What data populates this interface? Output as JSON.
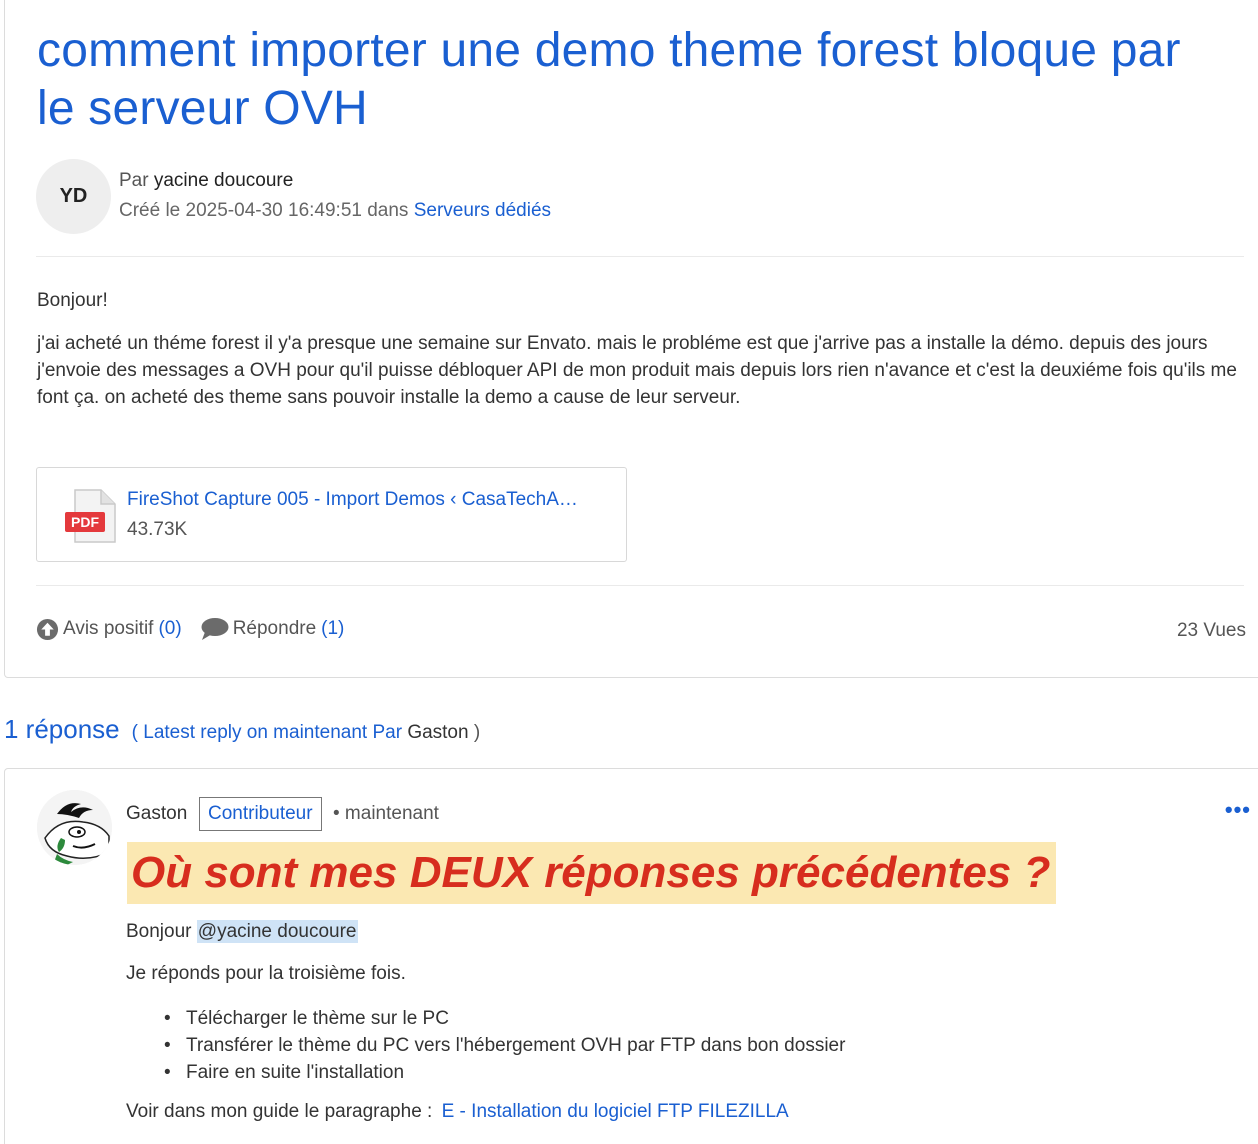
{
  "topic": {
    "title": "comment importer une demo theme forest bloque par le serveur OVH",
    "avatar_initials": "YD",
    "by_label": "Par",
    "author": "yacine doucoure",
    "created_label": "Créé le 2025-04-30 16:49:51 dans",
    "category": "Serveurs dédiés",
    "greeting": "Bonjour!",
    "body": "j'ai acheté un théme forest il y'a presque une semaine sur Envato. mais le probléme est que  j'arrive pas a installe la démo. depuis des jours j'envoie des messages a OVH pour qu'il puisse débloquer API de mon produit mais depuis lors rien n'avance et c'est la deuxiéme fois qu'ils me font ça. on acheté des theme sans pouvoir installe la demo a cause de leur serveur.",
    "attachment": {
      "icon": "pdf-icon",
      "icon_label": "PDF",
      "name": "FireShot Capture 005 - Import Demos ‹ CasaTechA…",
      "size": "43.73K"
    },
    "actions": {
      "upvote_label": "Avis positif",
      "upvote_count": "(0)",
      "reply_label": "Répondre",
      "reply_count": "(1)",
      "views": "23 Vues"
    }
  },
  "replies_header": {
    "count": "1 réponse",
    "latest_open": "( Latest reply on maintenant Par",
    "latest_author": "Gaston",
    "latest_close": ")"
  },
  "reply": {
    "author": "Gaston",
    "badge": "Contributeur",
    "time": "• maintenant",
    "menu_icon": "more-dots-icon",
    "heading": "Où sont mes DEUX réponses précédentes ?",
    "greeting": "Bonjour",
    "mention": "@yacine doucoure",
    "line2": "Je réponds pour la troisième fois.",
    "list": [
      "Télécharger le thème sur le PC",
      "Transférer le thème du PC vers l'hébergement OVH par FTP dans bon dossier",
      "Faire en suite l'installation"
    ],
    "guide_label": "Voir dans mon guide le paragraphe :",
    "guide_link": "E - Installation du logiciel FTP FILEZILLA"
  },
  "colors": {
    "link": "#1a5fd1",
    "highlight_bg": "#fbe8b2",
    "highlight_text": "#d72d1e",
    "mention_bg": "#cfe3f6"
  }
}
